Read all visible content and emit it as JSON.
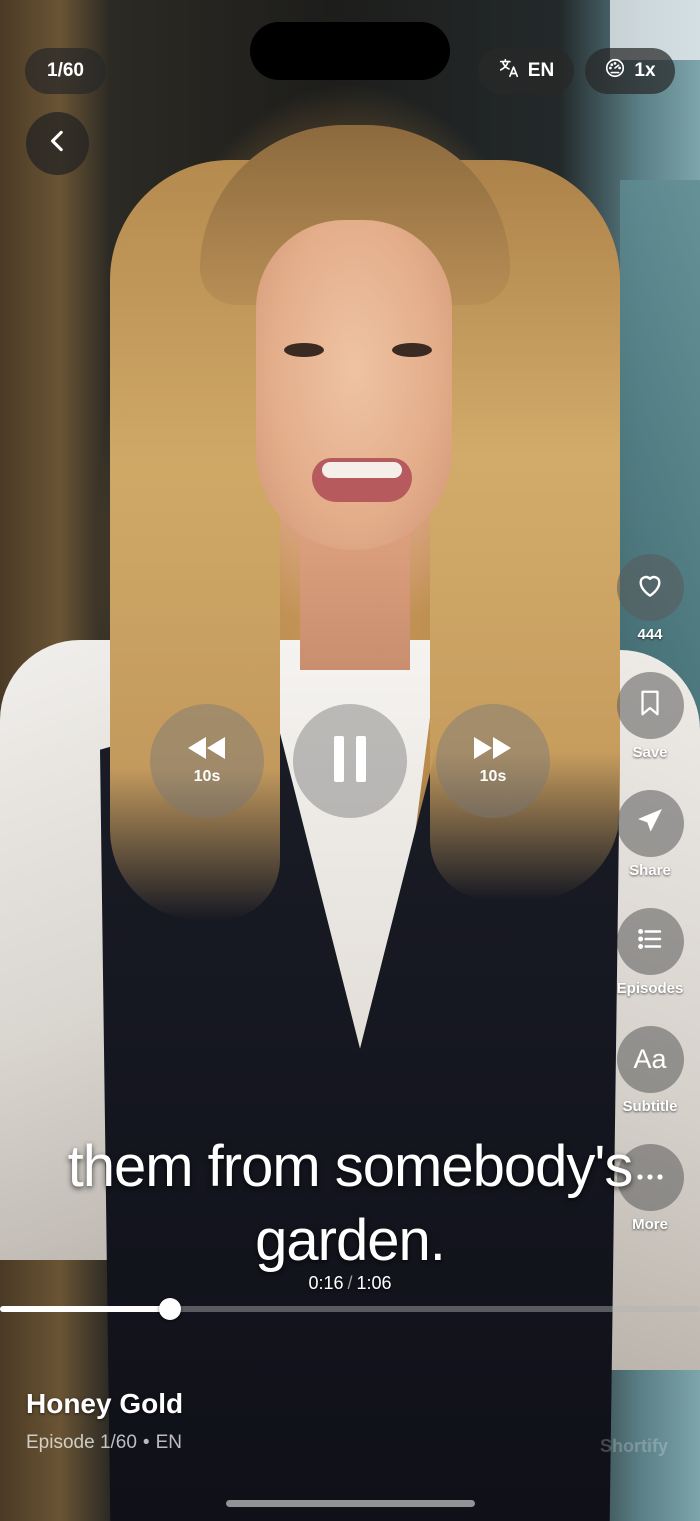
{
  "episode_counter": "1/60",
  "language_button": {
    "icon": "translate-icon",
    "label": "EN"
  },
  "speed_button": {
    "icon": "speedometer-icon",
    "label": "1x"
  },
  "back_button": {
    "icon": "chevron-left-icon"
  },
  "side_actions": [
    {
      "id": "like",
      "icon": "heart-icon",
      "label": "444"
    },
    {
      "id": "save",
      "icon": "bookmark-icon",
      "label": "Save"
    },
    {
      "id": "share",
      "icon": "paper-plane-icon",
      "label": "Share"
    },
    {
      "id": "episodes",
      "icon": "list-icon",
      "label": "Episodes"
    },
    {
      "id": "subtitle",
      "icon": "font-aa-icon",
      "label": "Subtitle"
    },
    {
      "id": "more",
      "icon": "ellipsis-icon",
      "label": "More"
    }
  ],
  "playback_controls": {
    "rewind_label": "10s",
    "forward_label": "10s",
    "state": "playing"
  },
  "subtitle": {
    "line1": "them from somebody's",
    "line2": "garden."
  },
  "progress": {
    "current": "0:16",
    "separator": "/",
    "total": "1:06",
    "fraction": 0.2424
  },
  "show": {
    "title": "Honey Gold",
    "episode": "Episode 1/60",
    "language": "EN"
  },
  "watermark": "Shortify",
  "colors": {
    "overlay_pill": "#282828",
    "progress_fill": "#ffffff",
    "progress_track": "#b4b4b4"
  }
}
